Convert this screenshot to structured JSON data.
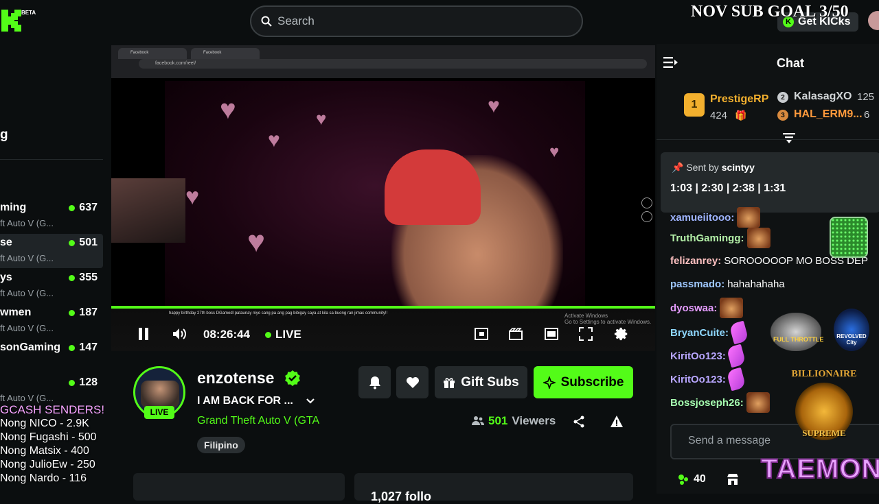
{
  "header": {
    "logo_badge": "BETA",
    "search_placeholder": "Search",
    "sub_goal": "NOV SUB GOAL 3/50",
    "get_kicks": "Get KICks"
  },
  "sidebar": {
    "section_title": "g",
    "channels": [
      {
        "name": "ming",
        "game": "ft Auto V (G...",
        "viewers": "637"
      },
      {
        "name": "se",
        "game": "ft Auto V (G...",
        "viewers": "501"
      },
      {
        "name": "ys",
        "game": "ft Auto V (G...",
        "viewers": "355"
      },
      {
        "name": "wmen",
        "game": "ft Auto V (G...",
        "viewers": "187"
      },
      {
        "name": "sonGaming",
        "game": "",
        "viewers": "147"
      },
      {
        "name": "",
        "game": "ft Auto V (G...",
        "viewers": "128"
      }
    ]
  },
  "overlay": {
    "gcash_title": "GCASH SENDERS!",
    "gcash_list": [
      "Nong NICO - 2.9K",
      "Nong Fugashi - 500",
      "Nong Matsix - 400",
      "Nong JulioEw - 250",
      "Nong Nardo - 116"
    ]
  },
  "player": {
    "tab1": "Facebook",
    "tab2": "Facebook",
    "url": "facebook.com/reel/",
    "time": "08:26:44",
    "live_label": "LIVE",
    "caption": "happy birthday 27th boss DGamedl pataunay niyo sang pa ang pag bibigay saya at kila sa buong ran jimac community!!",
    "activate_line1": "Activate Windows",
    "activate_line2": "Go to Settings to activate Windows."
  },
  "channel": {
    "name": "enzotense",
    "live_badge": "LIVE",
    "title": "I AM BACK FOR ...",
    "game": "Grand Theft Auto V (GTA",
    "tag": "Filipino",
    "gift_subs": "Gift Subs",
    "subscribe": "Subscribe",
    "viewer_count": "501",
    "viewers_label": "Viewers",
    "panel_text": "1,027 follo"
  },
  "chat": {
    "title": "Chat",
    "leaderboard": {
      "first": {
        "rank": "1",
        "name": "PrestigeRP",
        "count": "424"
      },
      "second": {
        "rank": "2",
        "name": "KalasagXO",
        "count": "125"
      },
      "third": {
        "rank": "3",
        "name": "HAL_ERM9...",
        "count": "6"
      }
    },
    "pinned": {
      "sent_by_label": "Sent by",
      "sender": "scintyy",
      "message": "1:03 | 2:30 | 2:38 | 1:31"
    },
    "messages": [
      {
        "user": "xamueiitooo:",
        "color": "#9fb4ff",
        "text": ""
      },
      {
        "user": "TruthGamingg:",
        "color": "#b4f0a8",
        "text": ""
      },
      {
        "user": "felizanrey:",
        "color": "#ffc2c2",
        "text": "SOROOOOOP MO BOSS DEP"
      },
      {
        "user": "passmado:",
        "color": "#9fc8ff",
        "text": "hahahahaha"
      },
      {
        "user": "dyoswaa:",
        "color": "#e59cff",
        "text": ""
      },
      {
        "user": "BryanCuite:",
        "color": "#8fd8ff",
        "text": ""
      },
      {
        "user": "KiritOo123:",
        "color": "#b8a6ff",
        "text": ""
      },
      {
        "user": "KiritOo123:",
        "color": "#b8a6ff",
        "text": ""
      },
      {
        "user": "Bossjoseph26:",
        "color": "#a6ffb0",
        "text": ""
      }
    ],
    "input_placeholder": "Send a message",
    "points": "40",
    "overlay_logos": {
      "full_throttle": "FULL THROTTLE",
      "revolved": "REVOLVED City",
      "billionaire_top": "BILLIONAIRE",
      "billionaire_bottom": "SUPREME",
      "taemon": "TAEMON"
    }
  },
  "colors": {
    "accent": "#53fc18",
    "background": "#0b0e0f",
    "chat_bg": "#0f1213"
  }
}
